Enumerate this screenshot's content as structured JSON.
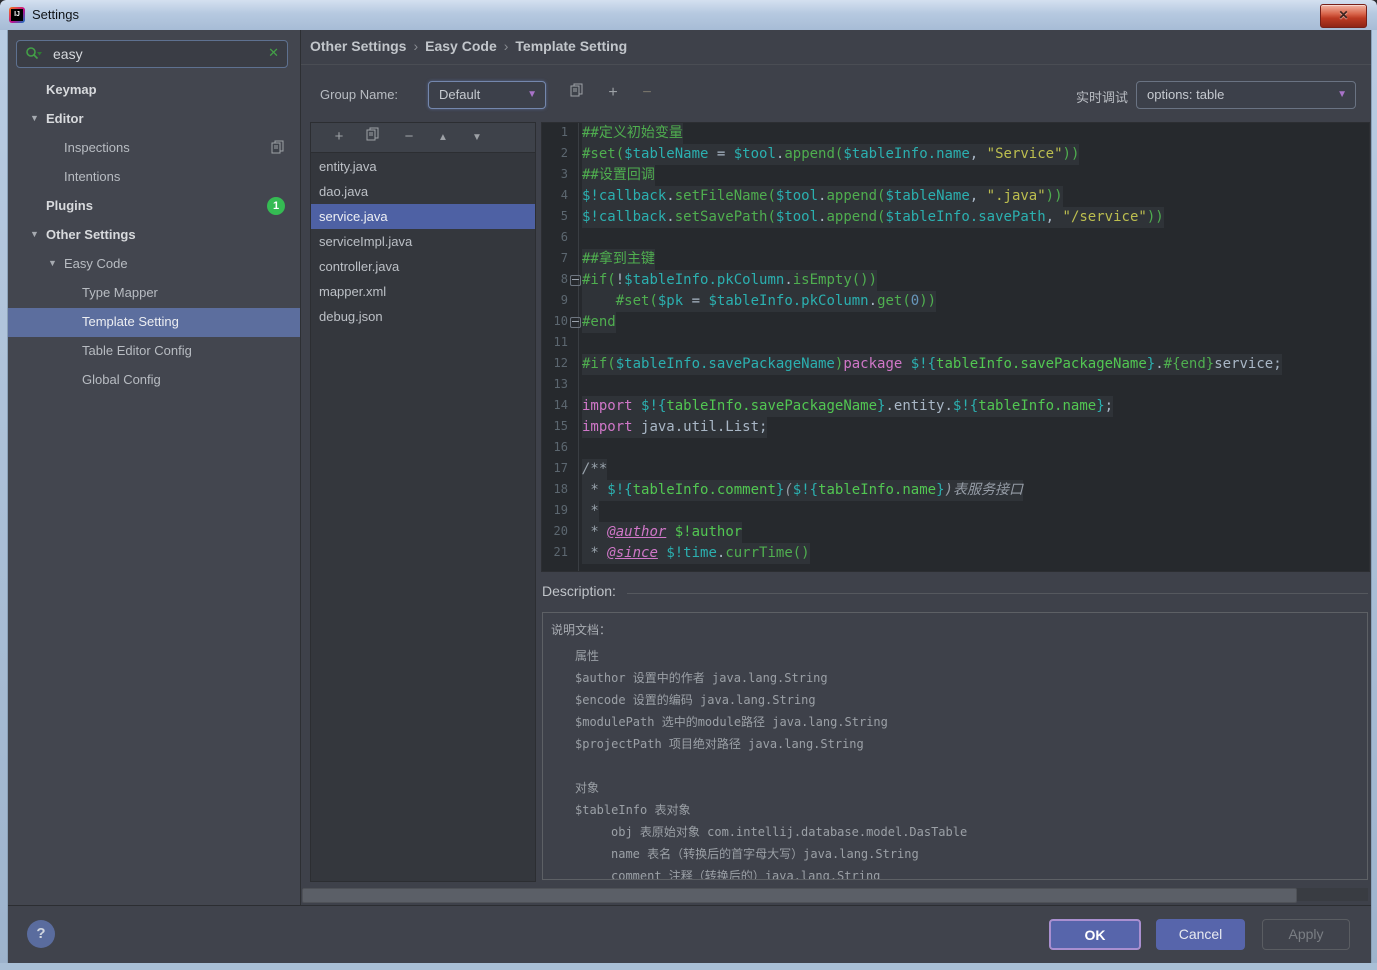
{
  "window": {
    "title": "Settings",
    "close_glyph": "✕"
  },
  "icons": {
    "add": "+",
    "remove": "−",
    "up": "▲",
    "down": "▼",
    "expanded": "▼",
    "search_clear": "✕",
    "help": "?"
  },
  "search": {
    "value": "easy"
  },
  "sidebar": {
    "tree": [
      {
        "label": "Keymap",
        "bold": true,
        "level": 1
      },
      {
        "label": "Editor",
        "bold": true,
        "level": 1,
        "expanded": true
      },
      {
        "label": "Inspections",
        "level": 2,
        "trail_icon": "copy"
      },
      {
        "label": "Intentions",
        "level": 2
      },
      {
        "label": "Plugins",
        "bold": true,
        "level": 1,
        "badge": "1"
      },
      {
        "label": "Other Settings",
        "bold": true,
        "level": 1,
        "expanded": true
      },
      {
        "label": "Easy Code",
        "level": 2,
        "expanded": true
      },
      {
        "label": "Type Mapper",
        "level": 3
      },
      {
        "label": "Template Setting",
        "level": 3,
        "selected": true
      },
      {
        "label": "Table Editor Config",
        "level": 3
      },
      {
        "label": "Global Config",
        "level": 3
      }
    ]
  },
  "breadcrumb": {
    "items": [
      "Other Settings",
      "Easy Code",
      "Template Setting"
    ],
    "separator": "›"
  },
  "group": {
    "label": "Group Name:",
    "value": "Default"
  },
  "debug": {
    "label": "实时调试",
    "value": "options: table"
  },
  "template_list": {
    "items": [
      "entity.java",
      "dao.java",
      "service.java",
      "serviceImpl.java",
      "controller.java",
      "mapper.xml",
      "debug.json"
    ],
    "selected_index": 2
  },
  "editor": {
    "lines": [
      {
        "num": "1",
        "runs": [
          [
            "grn",
            "##定义初始变量"
          ]
        ]
      },
      {
        "num": "2",
        "runs": [
          [
            "grn",
            "#set("
          ],
          [
            "cyn",
            "$tableName"
          ],
          [
            "fg",
            " = "
          ],
          [
            "cyn",
            "$tool"
          ],
          [
            "fg",
            "."
          ],
          [
            "grn",
            "append("
          ],
          [
            "cyn",
            "$tableInfo.name"
          ],
          [
            "fg",
            ", "
          ],
          [
            "yel",
            "\"Service\""
          ],
          [
            "grn",
            "))"
          ]
        ]
      },
      {
        "num": "3",
        "runs": [
          [
            "grn",
            "##设置回调"
          ]
        ]
      },
      {
        "num": "4",
        "runs": [
          [
            "cyn",
            "$!callback"
          ],
          [
            "fg",
            "."
          ],
          [
            "grn",
            "setFileName("
          ],
          [
            "cyn",
            "$tool"
          ],
          [
            "fg",
            "."
          ],
          [
            "grn",
            "append("
          ],
          [
            "cyn",
            "$tableName"
          ],
          [
            "fg",
            ", "
          ],
          [
            "yel",
            "\".java\""
          ],
          [
            "grn",
            "))"
          ]
        ]
      },
      {
        "num": "5",
        "runs": [
          [
            "cyn",
            "$!callback"
          ],
          [
            "fg",
            "."
          ],
          [
            "grn",
            "setSavePath("
          ],
          [
            "cyn",
            "$tool"
          ],
          [
            "fg",
            "."
          ],
          [
            "grn",
            "append("
          ],
          [
            "cyn",
            "$tableInfo.savePath"
          ],
          [
            "fg",
            ", "
          ],
          [
            "yel",
            "\"/service\""
          ],
          [
            "grn",
            "))"
          ]
        ]
      },
      {
        "num": "6",
        "runs": []
      },
      {
        "num": "7",
        "runs": [
          [
            "grn",
            "##拿到主键"
          ]
        ]
      },
      {
        "num": "8",
        "fold": "open",
        "runs": [
          [
            "grn",
            "#if("
          ],
          [
            "fg",
            "!"
          ],
          [
            "cyn",
            "$tableInfo.pkColumn"
          ],
          [
            "fg",
            "."
          ],
          [
            "grn",
            "isEmpty())"
          ]
        ]
      },
      {
        "num": "9",
        "runs": [
          [
            "fg",
            "    "
          ],
          [
            "grn",
            "#set("
          ],
          [
            "cyn",
            "$pk"
          ],
          [
            "fg",
            " = "
          ],
          [
            "cyn",
            "$tableInfo.pkColumn"
          ],
          [
            "fg",
            "."
          ],
          [
            "grn",
            "get("
          ],
          [
            "num",
            "0"
          ],
          [
            "grn",
            "))"
          ]
        ]
      },
      {
        "num": "10",
        "fold": "close",
        "runs": [
          [
            "grn",
            "#end"
          ]
        ]
      },
      {
        "num": "11",
        "runs": []
      },
      {
        "num": "12",
        "runs": [
          [
            "grn",
            "#if("
          ],
          [
            "cyn",
            "$tableInfo.savePackageName"
          ],
          [
            "grn",
            ")"
          ],
          [
            "pnk",
            "package "
          ],
          [
            "cyn",
            "$!{"
          ],
          [
            "grn2",
            "tableInfo.savePackageName"
          ],
          [
            "cyn",
            "}"
          ],
          [
            "fg",
            "."
          ],
          [
            "grn",
            "#{end}"
          ],
          [
            "fg",
            "service;"
          ]
        ]
      },
      {
        "num": "13",
        "runs": []
      },
      {
        "num": "14",
        "runs": [
          [
            "pnk",
            "import "
          ],
          [
            "cyn",
            "$!{"
          ],
          [
            "grn2",
            "tableInfo.savePackageName"
          ],
          [
            "cyn",
            "}"
          ],
          [
            "fg",
            ".entity."
          ],
          [
            "cyn",
            "$!{"
          ],
          [
            "grn2",
            "tableInfo.name"
          ],
          [
            "cyn",
            "}"
          ],
          [
            "fg",
            ";"
          ]
        ]
      },
      {
        "num": "15",
        "runs": [
          [
            "pnk",
            "import "
          ],
          [
            "fg",
            "java.util.List;"
          ]
        ]
      },
      {
        "num": "16",
        "runs": []
      },
      {
        "num": "17",
        "runs": [
          [
            "doc",
            "/**"
          ]
        ]
      },
      {
        "num": "18",
        "runs": [
          [
            "doc",
            " * "
          ],
          [
            "cyn",
            "$!{"
          ],
          [
            "grn2",
            "tableInfo.comment"
          ],
          [
            "cyn",
            "}"
          ],
          [
            "doci",
            "("
          ],
          [
            "cyn",
            "$!{"
          ],
          [
            "grn2",
            "tableInfo.name"
          ],
          [
            "cyn",
            "}"
          ],
          [
            "doci",
            ")表服务接口"
          ]
        ]
      },
      {
        "num": "19",
        "runs": [
          [
            "doc",
            " *"
          ]
        ]
      },
      {
        "num": "20",
        "runs": [
          [
            "doc",
            " * "
          ],
          [
            "tag",
            "@author"
          ],
          [
            "fg",
            " "
          ],
          [
            "grn2",
            "$!author"
          ]
        ]
      },
      {
        "num": "21",
        "runs": [
          [
            "doc",
            " * "
          ],
          [
            "tag",
            "@since"
          ],
          [
            "fg",
            " "
          ],
          [
            "cyn",
            "$!time"
          ],
          [
            "fg",
            "."
          ],
          [
            "grn",
            "currTime()"
          ]
        ]
      }
    ]
  },
  "description": {
    "label": "Description:",
    "lines": [
      {
        "ind": 0,
        "text": "说明文档："
      },
      {
        "ind": 1,
        "text": "属性"
      },
      {
        "ind": 1,
        "text": "$author 设置中的作者 java.lang.String"
      },
      {
        "ind": 1,
        "text": "$encode 设置的编码 java.lang.String"
      },
      {
        "ind": 1,
        "text": "$modulePath 选中的module路径 java.lang.String"
      },
      {
        "ind": 1,
        "text": "$projectPath 项目绝对路径 java.lang.String"
      },
      {
        "ind": 0,
        "text": ""
      },
      {
        "ind": 1,
        "text": "对象"
      },
      {
        "ind": 1,
        "text": "$tableInfo 表对象"
      },
      {
        "ind": 2,
        "text": "obj 表原始对象 com.intellij.database.model.DasTable"
      },
      {
        "ind": 2,
        "text": "name 表名（转换后的首字母大写）java.lang.String"
      },
      {
        "ind": 2,
        "text": "comment 注释（转换后的）java.lang.String"
      }
    ]
  },
  "buttons": {
    "ok": "OK",
    "cancel": "Cancel",
    "apply": "Apply"
  }
}
